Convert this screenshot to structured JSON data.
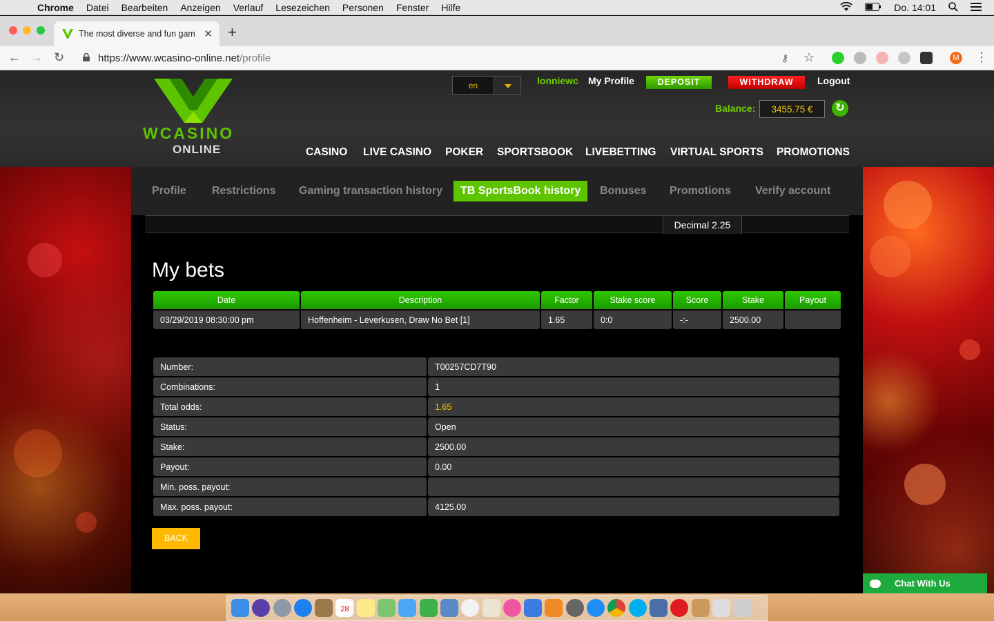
{
  "menubar": {
    "app": "Chrome",
    "items": [
      "Datei",
      "Bearbeiten",
      "Anzeigen",
      "Verlauf",
      "Lesezeichen",
      "Personen",
      "Fenster",
      "Hilfe"
    ],
    "clock": "Do. 14:01"
  },
  "browser": {
    "tab_title": "The most diverse and fun gam",
    "url_host": "https://www.wcasino-online.net",
    "url_path": "/profile",
    "profile_initial": "M"
  },
  "site": {
    "logo_line1": "WCASINO",
    "logo_line2": "ONLINE",
    "language": "en",
    "username": "lonniewc",
    "my_profile": "My Profile",
    "deposit": "DEPOSIT",
    "withdraw": "WITHDRAW",
    "logout": "Logout",
    "balance_label": "Balance:",
    "balance_value": "3455.75 €",
    "nav": [
      "CASINO",
      "LIVE CASINO",
      "POKER",
      "SPORTSBOOK",
      "LIVEBETTING",
      "VIRTUAL SPORTS",
      "PROMOTIONS"
    ],
    "subtabs": [
      "Profile",
      "Restrictions",
      "Gaming transaction history",
      "TB SportsBook history",
      "Bonuses",
      "Promotions",
      "Verify account"
    ],
    "active_subtab": "TB SportsBook history",
    "odds_format": "Decimal 2.25",
    "page_title": "My bets",
    "bets_columns": [
      "Date",
      "Description",
      "Factor",
      "Stake score",
      "Score",
      "Stake",
      "Payout"
    ],
    "bets_rows": [
      [
        "03/29/2019 08:30:00 pm",
        "Hoffenheim - Leverkusen, Draw No Bet [1]",
        "1.65",
        "0:0",
        "-:-",
        "2500.00",
        ""
      ]
    ],
    "details": [
      {
        "label": "Number:",
        "value": "T00257CD7T90"
      },
      {
        "label": "Combinations:",
        "value": "1"
      },
      {
        "label": "Total odds:",
        "value": "1.65"
      },
      {
        "label": "Status:",
        "value": "Open"
      },
      {
        "label": "Stake:",
        "value": "2500.00"
      },
      {
        "label": "Payout:",
        "value": "0.00"
      },
      {
        "label": "Min. poss. payout:",
        "value": ""
      },
      {
        "label": "Max. poss. payout:",
        "value": "4125.00"
      }
    ],
    "back": "BACK",
    "chat": "Chat With Us"
  },
  "colors": {
    "accent_green": "#5ec400",
    "deposit": "#3cb400",
    "withdraw": "#e00000",
    "balance_text": "#f0c800",
    "back_button": "#ffb900",
    "chat": "#1eaa3c"
  },
  "dock_calendar_day": "28"
}
